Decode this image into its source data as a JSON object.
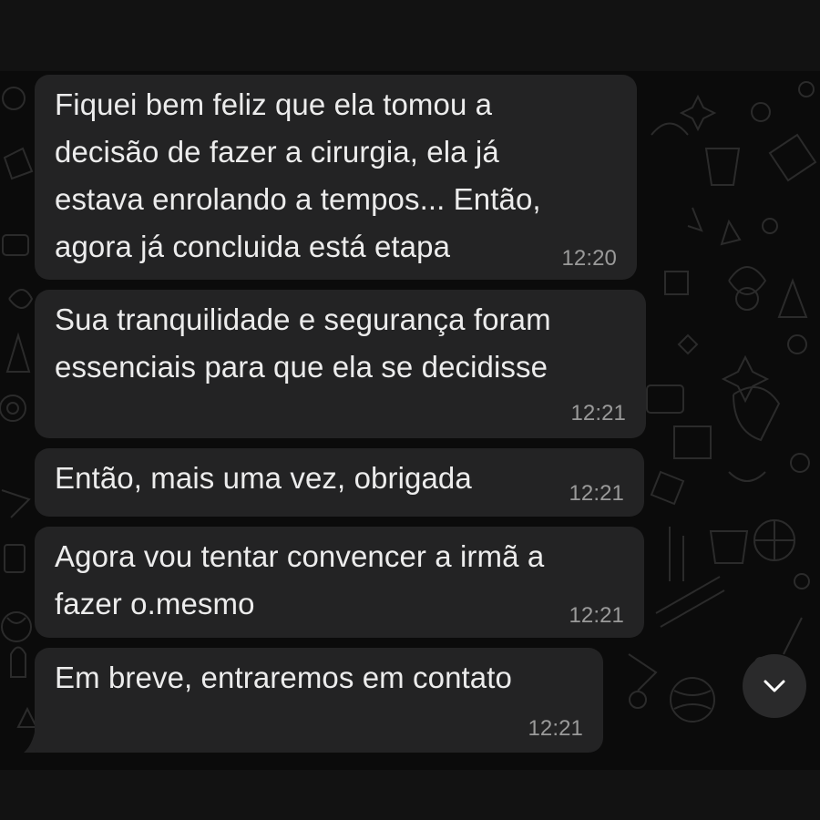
{
  "messages": [
    {
      "lines": [
        "Fiquei bem feliz que ela tomou a",
        "decisão de fazer a cirurgia, ela já",
        "estava enrolando a tempos... Então,",
        "agora já concluida está etapa"
      ],
      "time": "12:20"
    },
    {
      "lines": [
        "Sua tranquilidade e segurança foram",
        "essenciais para que ela se decidisse"
      ],
      "time": "12:21"
    },
    {
      "lines": [
        "Então, mais uma vez, obrigada"
      ],
      "time": "12:21"
    },
    {
      "lines": [
        "Agora vou tentar convencer a irmã a",
        "fazer o.mesmo"
      ],
      "time": "12:21"
    },
    {
      "lines": [
        "Em breve, entraremos em contato"
      ],
      "time": "12:21"
    }
  ],
  "scroll_button": {
    "icon": "chevron-down-icon"
  },
  "colors": {
    "bubble_incoming": "#232324",
    "background": "#0b0b0b",
    "text": "#ececec",
    "timestamp": "#9a9a9a"
  }
}
